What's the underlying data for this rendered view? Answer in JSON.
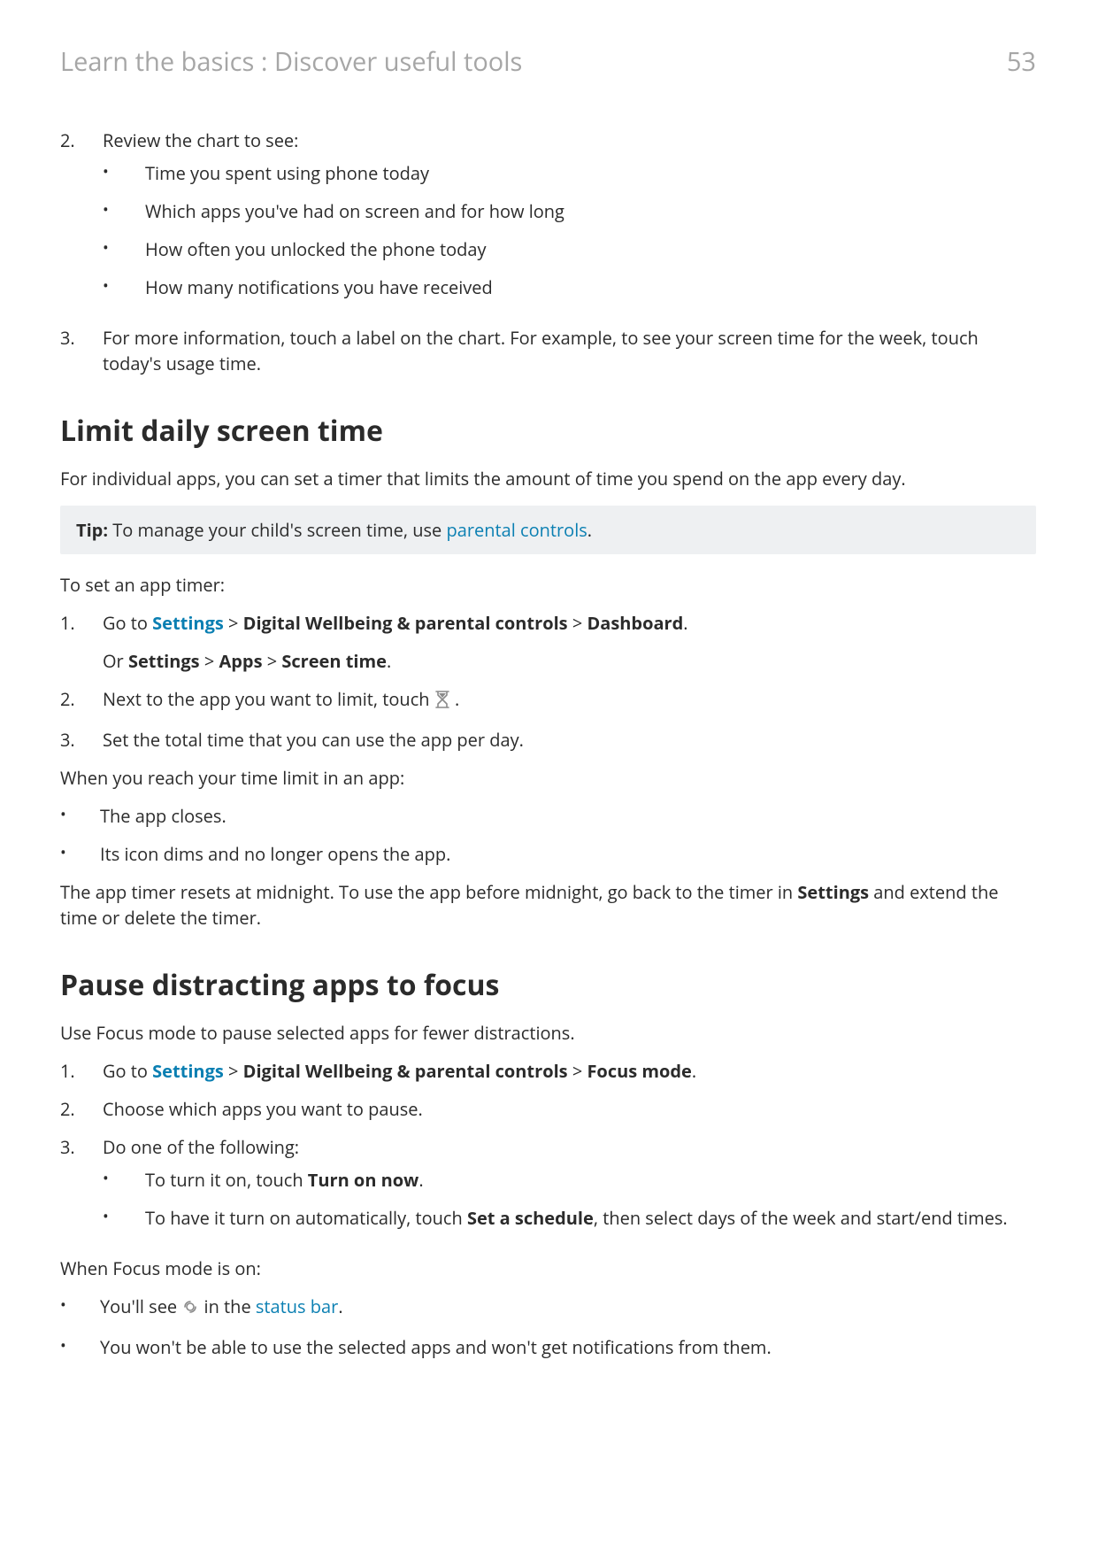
{
  "header": {
    "breadcrumb": "Learn the basics : Discover useful tools",
    "page_number": "53"
  },
  "list1": {
    "item2": {
      "marker": "2.",
      "lead": "Review the chart to see:",
      "bullets": [
        "Time you spent using phone today",
        "Which apps you've had on screen and for how long",
        "How often you unlocked the phone today",
        "How many notifications you have received"
      ]
    },
    "item3": {
      "marker": "3.",
      "text": "For more information, touch a label on the chart. For example, to see your screen time for the week, touch today's usage time."
    }
  },
  "section_limit": {
    "heading": "Limit daily screen time",
    "intro": "For individual apps, you can set a timer that limits the amount of time you spend on the app every day.",
    "tip_label": "Tip:",
    "tip_before_link": " To manage your child's screen time, use ",
    "tip_link": "parental controls",
    "tip_after_link": ".",
    "set_timer_lead": "To set an app timer:",
    "step1": {
      "marker": "1.",
      "text_1": "Go to ",
      "link": "Settings",
      "gt1": " > ",
      "bold1": "Digital Wellbeing & parental controls",
      "gt2": " > ",
      "bold2": "Dashboard",
      "tail": ".",
      "or_1": "Or ",
      "or_b1": "Settings",
      "or_gt1": " > ",
      "or_b2": "Apps",
      "or_gt2": " > ",
      "or_b3": "Screen time",
      "or_tail": "."
    },
    "step2": {
      "marker": "2.",
      "text_before": "Next to the app you want to limit, touch ",
      "text_after": " ."
    },
    "step3": {
      "marker": "3.",
      "text": "Set the total time that you can use the app per day."
    },
    "reach_limit_lead": "When you reach your time limit in an app:",
    "reach_bullets": [
      "The app closes.",
      "Its icon dims and no longer opens the app."
    ],
    "reset_before": "The app timer resets at midnight. To use the app before midnight, go back to the timer in ",
    "reset_bold": "Settings",
    "reset_after": " and extend the time or delete the timer."
  },
  "section_focus": {
    "heading": "Pause distracting apps to focus",
    "intro": "Use Focus mode to pause selected apps for fewer distractions.",
    "step1": {
      "marker": "1.",
      "text_1": "Go to ",
      "link": "Settings",
      "gt1": " > ",
      "bold1": "Digital Wellbeing & parental controls",
      "gt2": " > ",
      "bold2": "Focus mode",
      "tail": "."
    },
    "step2": {
      "marker": "2.",
      "text": "Choose which apps you want to pause."
    },
    "step3": {
      "marker": "3.",
      "lead": "Do one of the following:",
      "b1_before": "To turn it on, touch ",
      "b1_bold": "Turn on now",
      "b1_after": ".",
      "b2_before": "To have it turn on automatically, touch ",
      "b2_bold": "Set a schedule",
      "b2_after": ", then select days of the week and start/end times."
    },
    "when_on_lead": "When Focus mode is on:",
    "b_see_before": "You'll see ",
    "b_see_after_1": " in the ",
    "b_see_link": "status bar",
    "b_see_after_2": ".",
    "b_wont": "You won't be able to use the selected apps and won't get notifications from them."
  }
}
